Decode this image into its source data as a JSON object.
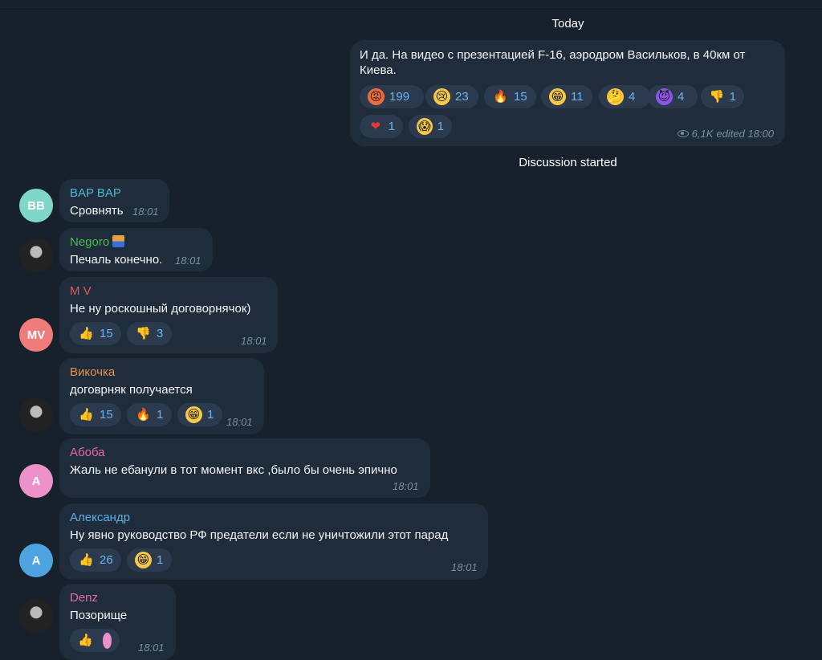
{
  "header": {
    "today": "Today",
    "discussion_started": "Discussion started"
  },
  "post": {
    "text": "И да. На видео с презентацией F-16, аэродром Васильков, в 40км от Киева.",
    "views": "6,1K",
    "edited_time": "edited 18:00",
    "reactions": [
      {
        "icon": "angry-face-icon",
        "glyph": "😡",
        "count": "199"
      },
      {
        "icon": "crying-face-icon",
        "glyph": "😢",
        "count": "23"
      },
      {
        "icon": "fire-icon",
        "glyph": "🔥",
        "count": "15"
      },
      {
        "icon": "grinning-face-icon",
        "glyph": "😁",
        "count": "11"
      },
      {
        "icon": "thinking-face-icon",
        "glyph": "🤔",
        "count": "4"
      },
      {
        "icon": "devil-face-icon",
        "glyph": "😈",
        "count": "4"
      },
      {
        "icon": "thumbs-down-icon",
        "glyph": "👎",
        "count": "1"
      },
      {
        "icon": "heart-icon",
        "glyph": "❤",
        "count": "1"
      },
      {
        "icon": "screaming-face-icon",
        "glyph": "😱",
        "count": "1"
      }
    ]
  },
  "comments": [
    {
      "name": "BAP BAP",
      "name_color": "#52b9d3",
      "avatar_text": "BB",
      "avatar_color": "#7ed7c8",
      "text": "Сровнять",
      "time": "18:01"
    },
    {
      "name": "Negoro",
      "name_color": "#4fb94f",
      "avatar_text": "",
      "avatar_color": "#2a2a2a",
      "badge_icon": "flag-badge-icon",
      "text": "Печаль конечно.",
      "time": "18:01"
    },
    {
      "name": "M V",
      "name_color": "#e35959",
      "avatar_text": "MV",
      "avatar_color": "#f07b7b",
      "text": "Не ну роскошный договорнячок)",
      "time": "18:01",
      "reactions": [
        {
          "icon": "thumbs-up-icon",
          "glyph": "👍",
          "count": "15"
        },
        {
          "icon": "thumbs-down-icon",
          "glyph": "👎",
          "count": "3"
        }
      ]
    },
    {
      "name": "Викочка",
      "name_color": "#e8924a",
      "avatar_text": "",
      "avatar_color": "#4a4440",
      "text": "договрняк получается",
      "time": "18:01",
      "reactions": [
        {
          "icon": "thumbs-up-icon",
          "glyph": "👍",
          "count": "15"
        },
        {
          "icon": "fire-icon",
          "glyph": "🔥",
          "count": "1"
        },
        {
          "icon": "grinning-face-icon",
          "glyph": "😁",
          "count": "1"
        }
      ]
    },
    {
      "name": "Абоба",
      "name_color": "#e668a4",
      "avatar_text": "А",
      "avatar_color": "#ec91c9",
      "text": "Жаль не ебанули в тот момент вкс ,было бы очень эпично",
      "time": "18:01"
    },
    {
      "name": "Александр",
      "name_color": "#5caee8",
      "avatar_text": "А",
      "avatar_color": "#4ea4e0",
      "text": "Ну явно руководство РФ предатели если не уничтожили этот парад",
      "time": "18:01",
      "reactions": [
        {
          "icon": "thumbs-up-icon",
          "glyph": "👍",
          "count": "26"
        },
        {
          "icon": "grinning-face-icon",
          "glyph": "😁",
          "count": "1"
        }
      ]
    },
    {
      "name": "Denz",
      "name_color": "#e668a4",
      "avatar_text": "",
      "avatar_color": "#333",
      "text": "Позорище",
      "time": "18:01",
      "reactions": [
        {
          "icon": "thumbs-up-icon",
          "glyph": "👍",
          "count": ""
        }
      ]
    }
  ]
}
